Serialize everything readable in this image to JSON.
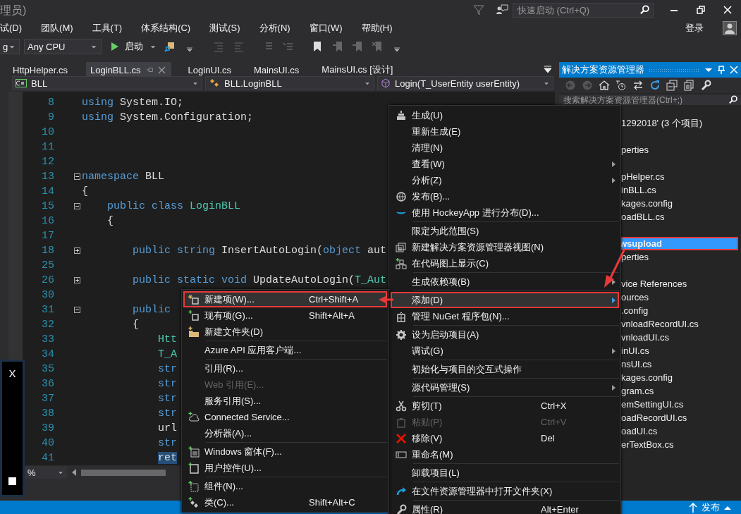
{
  "window": {
    "title": "理员)",
    "quick_launch": {
      "placeholder": "快速启动 (Ctrl+Q)"
    },
    "sign_in": "登录"
  },
  "menu_bar": [
    "试(D)",
    "团队(M)",
    "工具(T)",
    "体系结构(C)",
    "测试(S)",
    "分析(N)",
    "窗口(W)",
    "帮助(H)"
  ],
  "toolbar": {
    "configuration": "g",
    "platform": "Any CPU",
    "start": "启动"
  },
  "tabs": [
    {
      "label": "HttpHelper.cs",
      "selected": false
    },
    {
      "label": "LoginBLL.cs",
      "selected": true
    },
    {
      "label": "LoginUI.cs",
      "selected": false
    },
    {
      "label": "MainsUI.cs",
      "selected": false
    },
    {
      "label": "MainsUI.cs [设计]",
      "selected": false
    }
  ],
  "navigation": {
    "project": "BLL",
    "type": "BLL.LoginBLL",
    "member": "Login(T_UserEntity userEntity)"
  },
  "code_lines": [
    {
      "number": "8",
      "tokens": [
        {
          "kind": "keyword",
          "text": "using"
        },
        {
          "kind": "plain",
          "text": " System.IO;"
        }
      ]
    },
    {
      "number": "9",
      "tokens": [
        {
          "kind": "keyword",
          "text": "using"
        },
        {
          "kind": "plain",
          "text": " System.Configuration;"
        }
      ]
    },
    {
      "number": "10"
    },
    {
      "number": "11"
    },
    {
      "number": "12"
    },
    {
      "number": "13",
      "collapsed": false,
      "tokens": [
        {
          "kind": "keyword",
          "text": "namespace"
        },
        {
          "kind": "plain",
          "text": " BLL"
        }
      ]
    },
    {
      "number": "14",
      "tokens": [
        {
          "kind": "plain",
          "text": "{"
        }
      ]
    },
    {
      "number": "15",
      "collapsed": false,
      "tokens": [
        {
          "kind": "keyword",
          "text": "    public class"
        },
        {
          "kind": "type",
          "text": " LoginBLL"
        }
      ]
    },
    {
      "number": "16",
      "tokens": [
        {
          "kind": "plain",
          "text": "    {"
        }
      ]
    },
    {
      "number": "17"
    },
    {
      "number": "18",
      "collapsed": true,
      "tokens": [
        {
          "kind": "keyword",
          "text": "        public string"
        },
        {
          "kind": "plain",
          "text": " InsertAutoLogin("
        },
        {
          "kind": "keyword",
          "text": "object"
        },
        {
          "kind": "plain",
          "text": " aut"
        }
      ]
    },
    {
      "number": "25"
    },
    {
      "number": "26",
      "collapsed": true,
      "tokens": [
        {
          "kind": "keyword",
          "text": "        public static void"
        },
        {
          "kind": "plain",
          "text": " UpdateAutoLogin("
        },
        {
          "kind": "type",
          "text": "T_Aut"
        }
      ]
    },
    {
      "number": "30"
    },
    {
      "number": "31",
      "collapsed": false,
      "tokens": [
        {
          "kind": "keyword",
          "text": "        public"
        }
      ]
    },
    {
      "number": "32",
      "tokens": [
        {
          "kind": "plain",
          "text": "        {"
        }
      ]
    },
    {
      "number": "33",
      "tokens": [
        {
          "kind": "type",
          "text": "            Htt"
        }
      ]
    },
    {
      "number": "34",
      "tokens": [
        {
          "kind": "type",
          "text": "            T_A"
        }
      ]
    },
    {
      "number": "35",
      "tokens": [
        {
          "kind": "keyword",
          "text": "            str"
        }
      ]
    },
    {
      "number": "36",
      "tokens": [
        {
          "kind": "keyword",
          "text": "            str"
        }
      ]
    },
    {
      "number": "37",
      "tokens": [
        {
          "kind": "keyword",
          "text": "            str"
        }
      ]
    },
    {
      "number": "38",
      "tokens": [
        {
          "kind": "keyword",
          "text": "            str"
        }
      ]
    },
    {
      "number": "39",
      "tokens": [
        {
          "kind": "plain",
          "text": "            url"
        }
      ]
    },
    {
      "number": "40",
      "tokens": [
        {
          "kind": "keyword",
          "text": "            str"
        }
      ]
    },
    {
      "number": "41",
      "tokens": [
        {
          "kind": "selection",
          "text": "ret"
        }
      ]
    }
  ],
  "editor_footer": {
    "zoom": "%"
  },
  "floating_window": {
    "close": "X"
  },
  "solution_explorer": {
    "title": "解决方案资源管理器",
    "search": {
      "placeholder": "搜索解决方案资源管理器(Ctrl+;)"
    },
    "items": [
      {
        "kind": "item",
        "label": "1292018' (3 个项目)",
        "selected": false,
        "marked": false
      },
      {
        "kind": "gap"
      },
      {
        "kind": "item",
        "label": "perties",
        "selected": false,
        "marked": false
      },
      {
        "kind": "gap"
      },
      {
        "kind": "item",
        "label": "pHelper.cs",
        "selected": false,
        "marked": false
      },
      {
        "kind": "item",
        "label": "inBLL.cs",
        "selected": false,
        "marked": false
      },
      {
        "kind": "item",
        "label": "kages.config",
        "selected": false,
        "marked": false
      },
      {
        "kind": "item",
        "label": "oadBLL.cs",
        "selected": false,
        "marked": false
      },
      {
        "kind": "gap"
      },
      {
        "kind": "item",
        "label": "wsupload",
        "selected": true,
        "marked": true
      },
      {
        "kind": "item",
        "label": "perties",
        "selected": false,
        "marked": false
      },
      {
        "kind": "gap"
      },
      {
        "kind": "item",
        "label": "vice References",
        "selected": false,
        "marked": false
      },
      {
        "kind": "item",
        "label": "ources",
        "selected": false,
        "marked": false
      },
      {
        "kind": "item",
        "label": ".config",
        "selected": false,
        "marked": false
      },
      {
        "kind": "item",
        "label": "vnloadRecordUI.cs",
        "selected": false,
        "marked": false
      },
      {
        "kind": "item",
        "label": "vnloadUI.cs",
        "selected": false,
        "marked": false
      },
      {
        "kind": "item",
        "label": "inUI.cs",
        "selected": false,
        "marked": false
      },
      {
        "kind": "item",
        "label": "nsUI.cs",
        "selected": false,
        "marked": false
      },
      {
        "kind": "item",
        "label": "kages.config",
        "selected": false,
        "marked": false
      },
      {
        "kind": "item",
        "label": "gram.cs",
        "selected": false,
        "marked": false
      },
      {
        "kind": "item",
        "label": "emSettingUI.cs",
        "selected": false,
        "marked": false
      },
      {
        "kind": "item",
        "label": "oadRecordUI.cs",
        "selected": false,
        "marked": false
      },
      {
        "kind": "item",
        "label": "oadUI.cs",
        "selected": false,
        "marked": false
      },
      {
        "kind": "item",
        "label": "erTextBox.cs",
        "selected": false,
        "marked": false
      }
    ]
  },
  "context_menu": {
    "items": [
      {
        "kind": "item",
        "label": "生成(U)",
        "has_submenu": false,
        "disabled": false,
        "selected": false,
        "marked": false
      },
      {
        "kind": "item",
        "label": "重新生成(E)",
        "has_submenu": false,
        "disabled": false,
        "selected": false,
        "marked": false
      },
      {
        "kind": "item",
        "label": "清理(N)",
        "has_submenu": false,
        "disabled": false,
        "selected": false,
        "marked": false
      },
      {
        "kind": "item",
        "label": "查看(W)",
        "has_submenu": true,
        "disabled": false,
        "selected": false,
        "marked": false
      },
      {
        "kind": "item",
        "label": "分析(Z)",
        "has_submenu": true,
        "disabled": false,
        "selected": false,
        "marked": false
      },
      {
        "kind": "item",
        "label": "发布(B)...",
        "has_submenu": false,
        "disabled": false,
        "selected": false,
        "marked": false
      },
      {
        "kind": "item",
        "label": "使用 HockeyApp 进行分布(D)...",
        "has_submenu": false,
        "disabled": false,
        "selected": false,
        "marked": false
      },
      {
        "kind": "separator"
      },
      {
        "kind": "item",
        "label": "限定为此范围(S)",
        "has_submenu": false,
        "disabled": false,
        "selected": false,
        "marked": false
      },
      {
        "kind": "item",
        "label": "新建解决方案资源管理器视图(N)",
        "has_submenu": false,
        "disabled": false,
        "selected": false,
        "marked": false
      },
      {
        "kind": "item",
        "label": "在代码图上显示(C)",
        "has_submenu": false,
        "disabled": false,
        "selected": false,
        "marked": false
      },
      {
        "kind": "separator"
      },
      {
        "kind": "item",
        "label": "生成依赖项(B)",
        "has_submenu": true,
        "disabled": false,
        "selected": false,
        "marked": false
      },
      {
        "kind": "separator"
      },
      {
        "kind": "item",
        "label": "添加(D)",
        "has_submenu": true,
        "disabled": false,
        "selected": true,
        "marked": true
      },
      {
        "kind": "item",
        "label": "管理 NuGet 程序包(N)...",
        "has_submenu": false,
        "disabled": false,
        "selected": false,
        "marked": false
      },
      {
        "kind": "separator"
      },
      {
        "kind": "item",
        "label": "设为启动项目(A)",
        "has_submenu": false,
        "disabled": false,
        "selected": false,
        "marked": false
      },
      {
        "kind": "item",
        "label": "调试(G)",
        "has_submenu": true,
        "disabled": false,
        "selected": false,
        "marked": false
      },
      {
        "kind": "separator"
      },
      {
        "kind": "item",
        "label": "初始化与项目的交互式操作",
        "has_submenu": false,
        "disabled": false,
        "selected": false,
        "marked": false
      },
      {
        "kind": "separator"
      },
      {
        "kind": "item",
        "label": "源代码管理(S)",
        "has_submenu": true,
        "disabled": false,
        "selected": false,
        "marked": false
      },
      {
        "kind": "separator"
      },
      {
        "kind": "item",
        "label": "剪切(T)",
        "shortcut": "Ctrl+X",
        "has_submenu": false,
        "disabled": false,
        "selected": false,
        "marked": false
      },
      {
        "kind": "item",
        "label": "粘贴(P)",
        "shortcut": "Ctrl+V",
        "has_submenu": false,
        "disabled": true,
        "selected": false,
        "marked": false
      },
      {
        "kind": "item",
        "label": "移除(V)",
        "shortcut": "Del",
        "has_submenu": false,
        "disabled": false,
        "selected": false,
        "marked": false
      },
      {
        "kind": "item",
        "label": "重命名(M)",
        "has_submenu": false,
        "disabled": false,
        "selected": false,
        "marked": false
      },
      {
        "kind": "separator"
      },
      {
        "kind": "item",
        "label": "卸载项目(L)",
        "has_submenu": false,
        "disabled": false,
        "selected": false,
        "marked": false
      },
      {
        "kind": "separator"
      },
      {
        "kind": "item",
        "label": "在文件资源管理器中打开文件夹(X)",
        "has_submenu": false,
        "disabled": false,
        "selected": false,
        "marked": false
      },
      {
        "kind": "separator"
      },
      {
        "kind": "item",
        "label": "属性(R)",
        "shortcut": "Alt+Enter",
        "has_submenu": false,
        "disabled": false,
        "selected": false,
        "marked": false
      }
    ]
  },
  "add_submenu": {
    "items": [
      {
        "kind": "item",
        "label": "新建项(W)...",
        "shortcut": "Ctrl+Shift+A",
        "disabled": false,
        "selected": true,
        "marked": true
      },
      {
        "kind": "item",
        "label": "现有项(G)...",
        "shortcut": "Shift+Alt+A",
        "disabled": false,
        "selected": false,
        "marked": false
      },
      {
        "kind": "item",
        "label": "新建文件夹(D)",
        "disabled": false,
        "selected": false,
        "marked": false
      },
      {
        "kind": "separator"
      },
      {
        "kind": "item",
        "label": "Azure API 应用客户端...",
        "disabled": false,
        "selected": false,
        "marked": false
      },
      {
        "kind": "separator"
      },
      {
        "kind": "item",
        "label": "引用(R)...",
        "disabled": false,
        "selected": false,
        "marked": false
      },
      {
        "kind": "item",
        "label": "Web 引用(E)...",
        "disabled": true,
        "selected": false,
        "marked": false
      },
      {
        "kind": "item",
        "label": "服务引用(S)...",
        "disabled": false,
        "selected": false,
        "marked": false
      },
      {
        "kind": "item",
        "label": "Connected Service...",
        "disabled": false,
        "selected": false,
        "marked": false
      },
      {
        "kind": "item",
        "label": "分析器(A)...",
        "disabled": false,
        "selected": false,
        "marked": false
      },
      {
        "kind": "separator"
      },
      {
        "kind": "item",
        "label": "Windows 窗体(F)...",
        "disabled": false,
        "selected": false,
        "marked": false
      },
      {
        "kind": "item",
        "label": "用户控件(U)...",
        "disabled": false,
        "selected": false,
        "marked": false
      },
      {
        "kind": "separator"
      },
      {
        "kind": "item",
        "label": "组件(N)...",
        "disabled": false,
        "selected": false,
        "marked": false
      },
      {
        "kind": "item",
        "label": "类(C)...",
        "shortcut": "Shift+Alt+C",
        "disabled": false,
        "selected": false,
        "marked": false
      }
    ]
  },
  "status_bar": {
    "publish": "发布"
  }
}
